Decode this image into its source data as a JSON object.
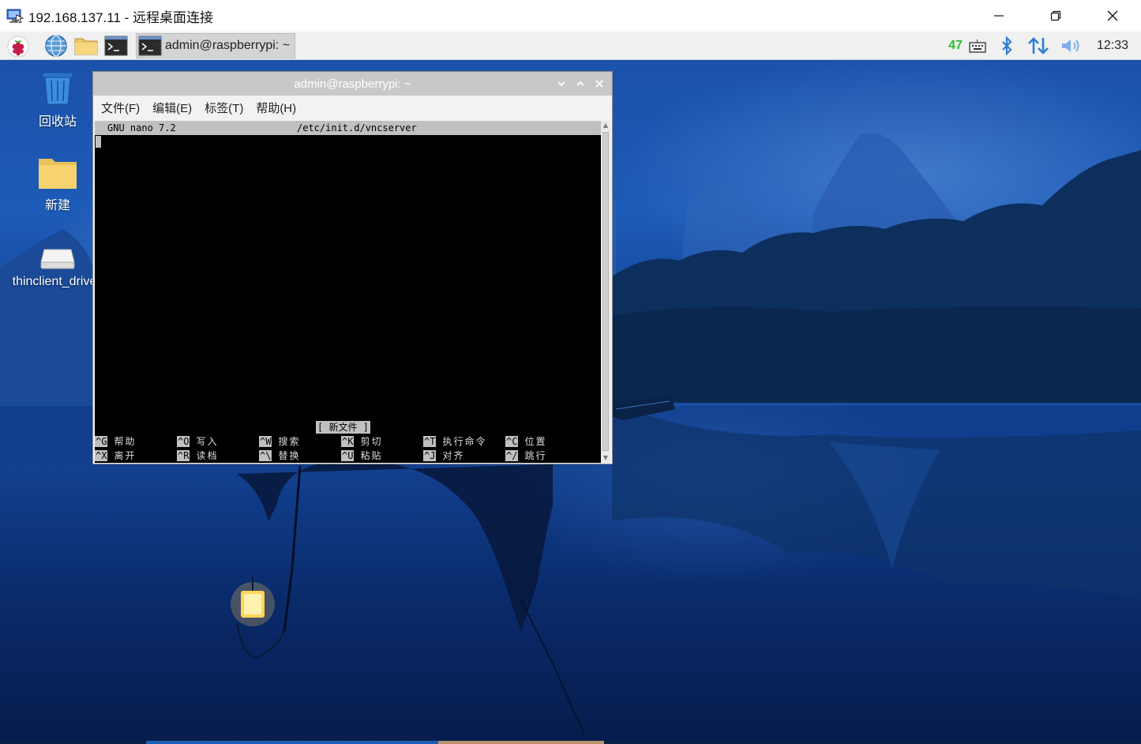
{
  "rdp_window": {
    "title": "192.168.137.11 - 远程桌面连接"
  },
  "panel": {
    "launchers": [
      "raspberry-menu",
      "web-browser",
      "file-manager",
      "terminal"
    ],
    "task_button_label": "admin@raspberrypi: ~",
    "cpu_value": "47",
    "clock": "12:33"
  },
  "desktop_icons": [
    {
      "label": "回收站"
    },
    {
      "label": "新建"
    },
    {
      "label": "thinclient_drives"
    }
  ],
  "terminal": {
    "title": "admin@raspberrypi: ~",
    "menu": [
      "文件(F)",
      "编辑(E)",
      "标签(T)",
      "帮助(H)"
    ],
    "nano": {
      "version": "GNU nano 7.2",
      "filename": "/etc/init.d/vncserver",
      "status": "[ 新文件 ]",
      "shortcuts_row1": [
        {
          "key": "^G",
          "label": "帮助"
        },
        {
          "key": "^O",
          "label": "写入"
        },
        {
          "key": "^W",
          "label": "搜索"
        },
        {
          "key": "^K",
          "label": "剪切"
        },
        {
          "key": "^T",
          "label": "执行命令"
        },
        {
          "key": "^C",
          "label": "位置"
        }
      ],
      "shortcuts_row2": [
        {
          "key": "^X",
          "label": "离开"
        },
        {
          "key": "^R",
          "label": "读档"
        },
        {
          "key": "^\\",
          "label": "替换"
        },
        {
          "key": "^U",
          "label": "粘贴"
        },
        {
          "key": "^J",
          "label": "对齐"
        },
        {
          "key": "^/",
          "label": "跳行"
        }
      ]
    }
  },
  "colors": {
    "cpu_green": "#2ebd2e",
    "panel_bg": "#f0f0f0",
    "terminal_bg": "#000000",
    "nano_highlight": "#c0c0c0",
    "tray_blue": "#2f7fd6"
  }
}
